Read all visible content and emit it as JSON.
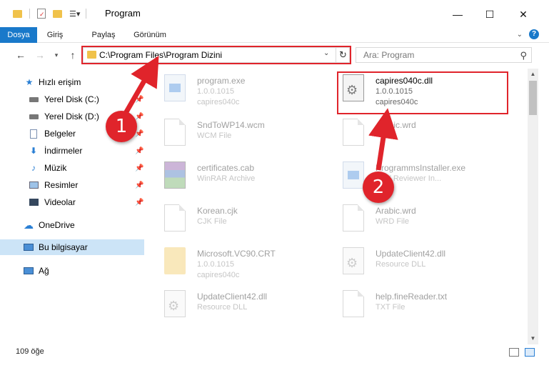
{
  "window": {
    "title": "Program",
    "controls": [
      "minimize-icon",
      "maximize-icon",
      "close-icon"
    ]
  },
  "ribbon": {
    "tabs": [
      {
        "label": "Dosya",
        "active": true
      },
      {
        "label": "Giriş",
        "active": false
      },
      {
        "label": "Paylaş",
        "active": false
      },
      {
        "label": "Görünüm",
        "active": false
      }
    ],
    "accent": "#1979ca"
  },
  "address": {
    "path": "C:\\Program Files\\Program Dizini",
    "search_placeholder": "Ara: Program"
  },
  "sidebar": {
    "items": [
      {
        "label": "Hızlı erişim",
        "icon": "star-icon",
        "pinned": false
      },
      {
        "label": "Yerel Disk (C:)",
        "icon": "drive-icon",
        "pinned": true
      },
      {
        "label": "Yerel Disk (D:)",
        "icon": "drive-icon",
        "pinned": true
      },
      {
        "label": "Belgeler",
        "icon": "documents-icon",
        "pinned": true
      },
      {
        "label": "İndirmeler",
        "icon": "download-icon",
        "pinned": true
      },
      {
        "label": "Müzik",
        "icon": "music-icon",
        "pinned": true
      },
      {
        "label": "Resimler",
        "icon": "pictures-icon",
        "pinned": true
      },
      {
        "label": "Videolar",
        "icon": "video-icon",
        "pinned": true
      },
      {
        "label": "OneDrive",
        "icon": "cloud-icon",
        "pinned": false
      },
      {
        "label": "Bu bilgisayar",
        "icon": "computer-icon",
        "pinned": false,
        "selected": true
      },
      {
        "label": "Ağ",
        "icon": "network-icon",
        "pinned": false
      }
    ]
  },
  "files": [
    {
      "name": "program.exe",
      "sub1": "1.0.0.1015",
      "sub2": "capires040c",
      "icon": "exe-file-icon",
      "highlighted": false
    },
    {
      "name": "capires040c.dll",
      "sub1": "1.0.0.1015",
      "sub2": "capires040c",
      "icon": "dll-gear-icon",
      "highlighted": true
    },
    {
      "name": "SndToWP14.wcm",
      "sub1": "WCM File",
      "sub2": "",
      "icon": "document-icon",
      "highlighted": false
    },
    {
      "name": "Arabic.wrd",
      "sub1": "",
      "sub2": "",
      "icon": "document-icon",
      "highlighted": false
    },
    {
      "name": "certificates.cab",
      "sub1": "WinRAR Archive",
      "sub2": "",
      "icon": "archive-icon",
      "highlighted": false
    },
    {
      "name": "ProgrammsInstaller.exe",
      "sub1": "BBY Reviewer In...",
      "sub2": "",
      "icon": "installer-icon",
      "highlighted": false
    },
    {
      "name": "Korean.cjk",
      "sub1": "CJK File",
      "sub2": "",
      "icon": "document-icon",
      "highlighted": false
    },
    {
      "name": "Arabic.wrd",
      "sub1": "WRD File",
      "sub2": "",
      "icon": "document-icon",
      "highlighted": false
    },
    {
      "name": "Microsoft.VC90.CRT",
      "sub1": "1.0.0.1015",
      "sub2": "capires040c",
      "icon": "folder-icon",
      "highlighted": false
    },
    {
      "name": "UpdateClient42.dll",
      "sub1": "Resource DLL",
      "sub2": "",
      "icon": "dll-gear-icon",
      "highlighted": false
    },
    {
      "name": "UpdateClient42.dll",
      "sub1": "Resource DLL",
      "sub2": "",
      "icon": "dll-gear-icon",
      "highlighted": false
    },
    {
      "name": "help.fineReader.txt",
      "sub1": "TXT File",
      "sub2": "",
      "icon": "document-icon",
      "highlighted": false
    }
  ],
  "status": {
    "item_count": "109 öğe"
  },
  "annotations": {
    "step1": "1",
    "step2": "2",
    "color": "#e0242b"
  }
}
